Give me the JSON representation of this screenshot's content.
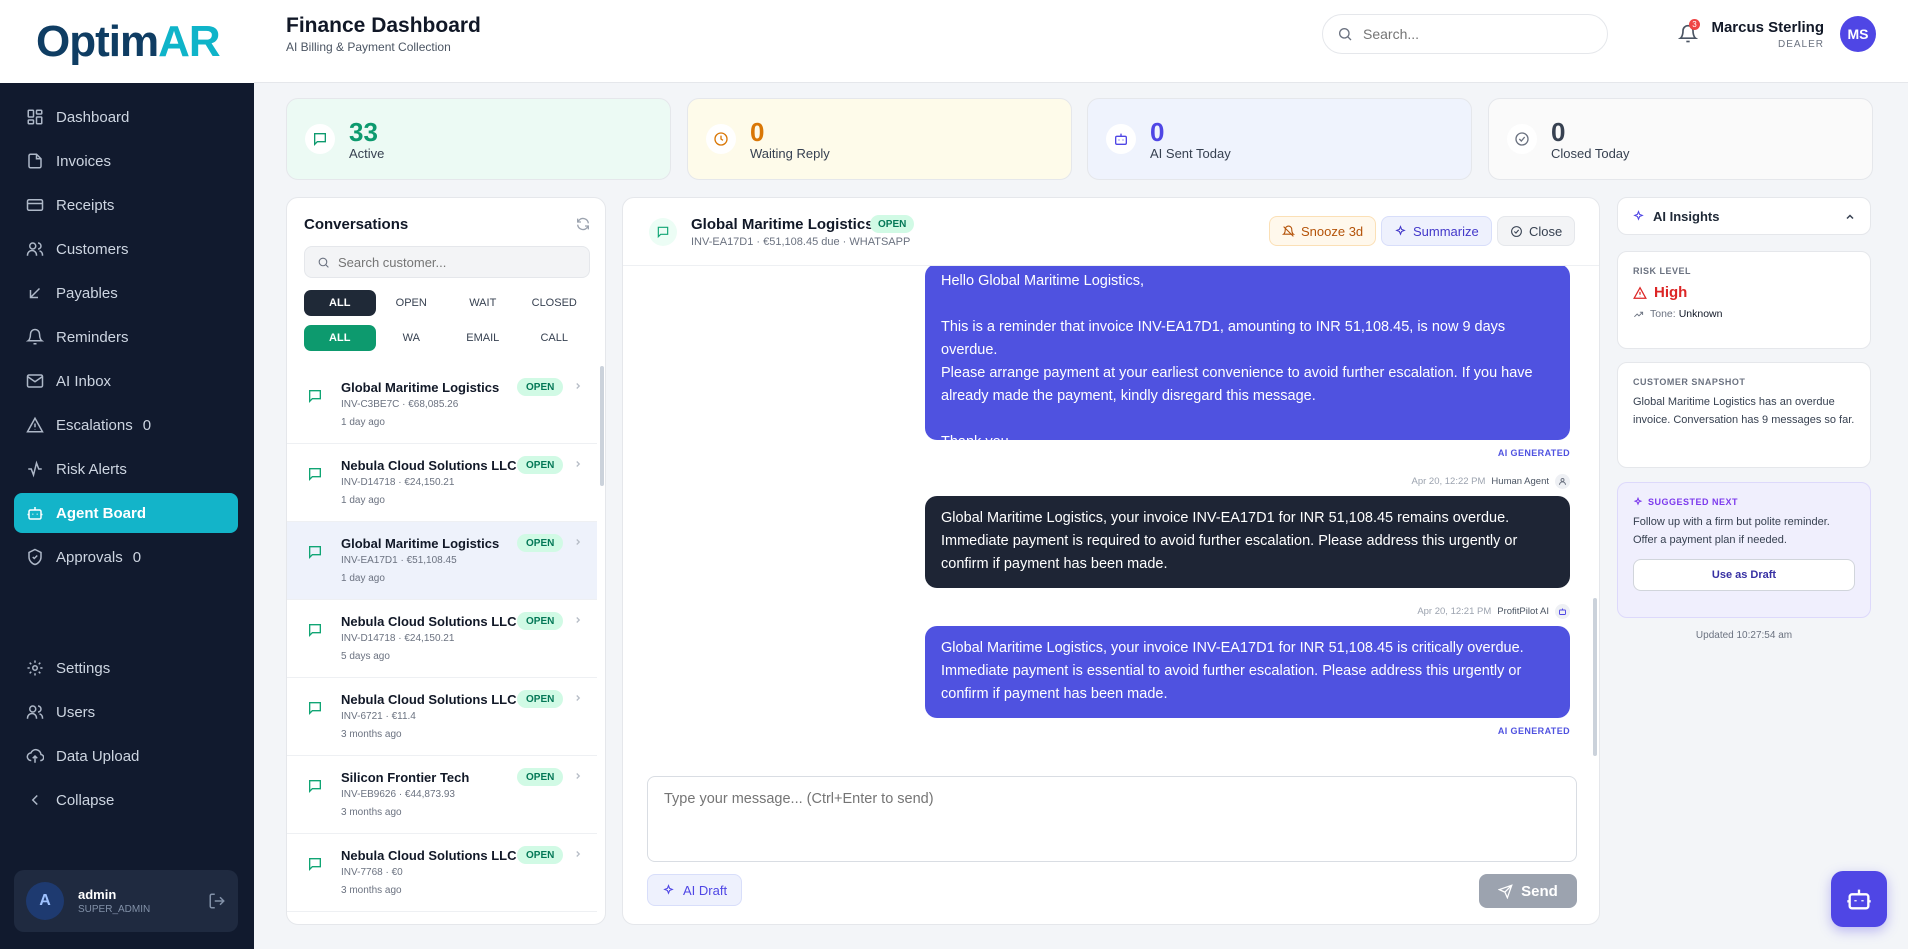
{
  "brand": {
    "logo_main": "Optim",
    "logo_accent": "AR"
  },
  "header": {
    "title": "Finance Dashboard",
    "subtitle": "AI Billing & Payment Collection",
    "search_placeholder": "Search...",
    "notification_count": "3",
    "user_name": "Marcus Sterling",
    "user_role": "DEALER",
    "user_initials": "MS"
  },
  "sidebar": {
    "items": [
      {
        "label": "Dashboard",
        "icon": "dashboard-icon"
      },
      {
        "label": "Invoices",
        "icon": "document-icon"
      },
      {
        "label": "Receipts",
        "icon": "card-icon"
      },
      {
        "label": "Customers",
        "icon": "users-icon"
      },
      {
        "label": "Payables",
        "icon": "arrow-down-left-icon"
      },
      {
        "label": "Reminders",
        "icon": "bell-icon"
      },
      {
        "label": "AI Inbox",
        "icon": "mail-icon"
      },
      {
        "label": "Escalations",
        "icon": "warning-icon",
        "count": "0"
      },
      {
        "label": "Risk Alerts",
        "icon": "pulse-icon"
      },
      {
        "label": "Agent Board",
        "icon": "bot-icon",
        "active": true
      },
      {
        "label": "Approvals",
        "icon": "shield-icon",
        "count": "0"
      }
    ],
    "bottom_items": [
      {
        "label": "Settings",
        "icon": "gear-icon"
      },
      {
        "label": "Users",
        "icon": "users-icon"
      },
      {
        "label": "Data Upload",
        "icon": "upload-icon"
      },
      {
        "label": "Collapse",
        "icon": "chevron-left-icon"
      }
    ],
    "user": {
      "initial": "A",
      "name": "admin",
      "role": "SUPER_ADMIN"
    }
  },
  "stats": [
    {
      "value": "33",
      "label": "Active",
      "color": "#0d9a6e",
      "bg": "#ecfaf4",
      "icon": "chat-icon"
    },
    {
      "value": "0",
      "label": "Waiting Reply",
      "color": "#d97706",
      "bg": "#fefbea",
      "icon": "clock-icon"
    },
    {
      "value": "0",
      "label": "AI Sent Today",
      "color": "#4f46e5",
      "bg": "#eff3fd",
      "icon": "bot-icon"
    },
    {
      "value": "0",
      "label": "Closed Today",
      "color": "#374151",
      "bg": "#fafafa",
      "icon": "check-circle-icon"
    }
  ],
  "conversations": {
    "title": "Conversations",
    "search_placeholder": "Search customer...",
    "status_filters": [
      "ALL",
      "OPEN",
      "WAIT",
      "CLOSED"
    ],
    "channel_filters": [
      "ALL",
      "WA",
      "EMAIL",
      "CALL"
    ],
    "items": [
      {
        "name": "Global Maritime Logistics",
        "invoice": "INV-C3BE7C · €68,085.26",
        "time": "1 day ago",
        "status": "OPEN"
      },
      {
        "name": "Nebula Cloud Solutions LLC",
        "invoice": "INV-D14718 · €24,150.21",
        "time": "1 day ago",
        "status": "OPEN"
      },
      {
        "name": "Global Maritime Logistics",
        "invoice": "INV-EA17D1 · €51,108.45",
        "time": "1 day ago",
        "status": "OPEN",
        "selected": true
      },
      {
        "name": "Nebula Cloud Solutions LLC",
        "invoice": "INV-D14718 · €24,150.21",
        "time": "5 days ago",
        "status": "OPEN"
      },
      {
        "name": "Nebula Cloud Solutions LLC",
        "invoice": "INV-6721 · €11.4",
        "time": "3 months ago",
        "status": "OPEN"
      },
      {
        "name": "Silicon Frontier Tech",
        "invoice": "INV-EB9626 · €44,873.93",
        "time": "3 months ago",
        "status": "OPEN"
      },
      {
        "name": "Nebula Cloud Solutions LLC",
        "invoice": "INV-7768 · €0",
        "time": "3 months ago",
        "status": "OPEN"
      }
    ]
  },
  "chat": {
    "customer": "Global Maritime Logistics",
    "status": "OPEN",
    "subtitle": "INV-EA17D1 · €51,108.45 due · WHATSAPP",
    "snooze_label": "Snooze 3d",
    "summarize_label": "Summarize",
    "close_label": "Close",
    "messages": [
      {
        "type": "ai",
        "lines": [
          "Hello Global Maritime Logistics,",
          "",
          "This is a reminder that invoice INV-EA17D1, amounting to INR 51,108.45, is now 9 days overdue.",
          "Please arrange payment at your earliest convenience to avoid further escalation. If you have",
          "already made the payment, kindly disregard this message.",
          "",
          "Thank you."
        ],
        "footer": "AI GENERATED"
      },
      {
        "type": "human",
        "time": "Apr 20, 12:22 PM",
        "sender": "Human Agent",
        "lines": [
          "Global Maritime Logistics, your invoice INV-EA17D1 for INR 51,108.45 remains overdue.",
          "Immediate payment is required to avoid further escalation. Please address this urgently or",
          "confirm if payment has been made."
        ]
      },
      {
        "type": "ai",
        "time": "Apr 20, 12:21 PM",
        "sender": "ProfitPilot AI",
        "lines": [
          "Global Maritime Logistics, your invoice INV-EA17D1 for INR 51,108.45 is critically overdue.",
          "Immediate payment is essential to avoid further escalation. Please address this urgently or",
          "confirm if payment has been made."
        ],
        "footer": "AI GENERATED"
      }
    ],
    "composer_placeholder": "Type your message... (Ctrl+Enter to send)",
    "ai_draft_label": "AI Draft",
    "send_label": "Send"
  },
  "insights": {
    "title": "AI Insights",
    "risk_caption": "RISK LEVEL",
    "risk_value": "High",
    "tone_label": "Tone:",
    "tone_value": "Unknown",
    "snapshot_caption": "CUSTOMER SNAPSHOT",
    "snapshot_text": "Global Maritime Logistics has an overdue invoice. Conversation has 9 messages so far.",
    "suggested_caption": "SUGGESTED NEXT",
    "suggested_text": "Follow up with a firm but polite reminder. Offer a payment plan if needed.",
    "use_draft_label": "Use as Draft",
    "updated": "Updated 10:27:54 am"
  }
}
